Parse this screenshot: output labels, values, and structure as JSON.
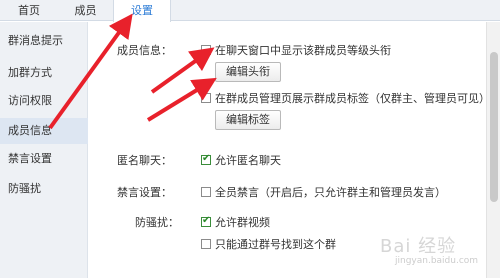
{
  "tabs": [
    {
      "label": "首页"
    },
    {
      "label": "成员"
    },
    {
      "label": "设置"
    }
  ],
  "sidebar": {
    "items": [
      {
        "label": "群消息提示"
      },
      {
        "label": "加群方式"
      },
      {
        "label": "访问权限"
      },
      {
        "label": "成员信息"
      },
      {
        "label": "禁言设置"
      },
      {
        "label": "防骚扰"
      }
    ]
  },
  "member_info": {
    "label": "成员信息：",
    "option1": "在聊天窗口中显示该群成员等级头衔",
    "option1_checked": false,
    "edit_title_button": "编辑头衔",
    "option2": "在群成员管理页展示群成员标签（仅群主、管理员可见）",
    "option2_checked": false,
    "edit_tags_button": "编辑标签"
  },
  "anonymous": {
    "label": "匿名聊天：",
    "option": "允许匿名聊天",
    "checked": true
  },
  "mute": {
    "label": "禁言设置：",
    "option": "全员禁言（开启后，只允许群主和管理员发言）",
    "checked": false
  },
  "anti_harass": {
    "label": "防骚扰：",
    "option1": "允许群视频",
    "option1_checked": true,
    "option2": "只能通过群号找到这个群",
    "option2_checked": false
  },
  "annotation": {
    "arrow_color": "#e8212b"
  },
  "watermark": {
    "text": "Bai 经验",
    "sub": "jingyan.baidu.com"
  }
}
